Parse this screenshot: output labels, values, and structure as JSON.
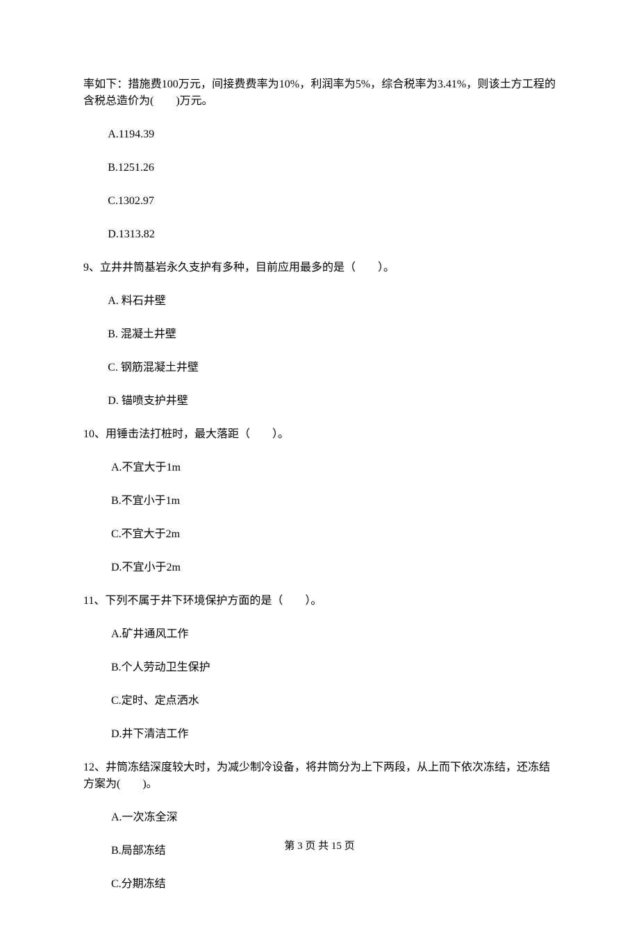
{
  "continuation": {
    "text": "率如下：措施费100万元，间接费费率为10%，利润率为5%，综合税率为3.41%，则该土方工程的含税总造价为(　　)万元。",
    "options": {
      "a": "A.1194.39",
      "b": "B.1251.26",
      "c": "C.1302.97",
      "d": "D.1313.82"
    }
  },
  "q9": {
    "stem": "9、立井井筒基岩永久支护有多种，目前应用最多的是（　　）。",
    "options": {
      "a": "A.  料石井壁",
      "b": "B.  混凝土井壁",
      "c": "C.  钢筋混凝土井壁",
      "d": "D.  锚喷支护井壁"
    }
  },
  "q10": {
    "stem": "10、用锤击法打桩时，最大落距（　　）。",
    "options": {
      "a": "A.不宜大于1m",
      "b": "B.不宜小于1m",
      "c": "C.不宜大于2m",
      "d": "D.不宜小于2m"
    }
  },
  "q11": {
    "stem": "11、下列不属于井下环境保护方面的是（　　）。",
    "options": {
      "a": "A.矿井通风工作",
      "b": "B.个人劳动卫生保护",
      "c": "C.定时、定点洒水",
      "d": "D.井下清洁工作"
    }
  },
  "q12": {
    "stem": "12、井筒冻结深度较大时，为减少制冷设备，将井筒分为上下两段，从上而下依次冻结，还冻结方案为(　　)。",
    "options": {
      "a": "A.一次冻全深",
      "b": "B.局部冻结",
      "c": "C.分期冻结"
    }
  },
  "footer": "第 3 页 共 15 页"
}
